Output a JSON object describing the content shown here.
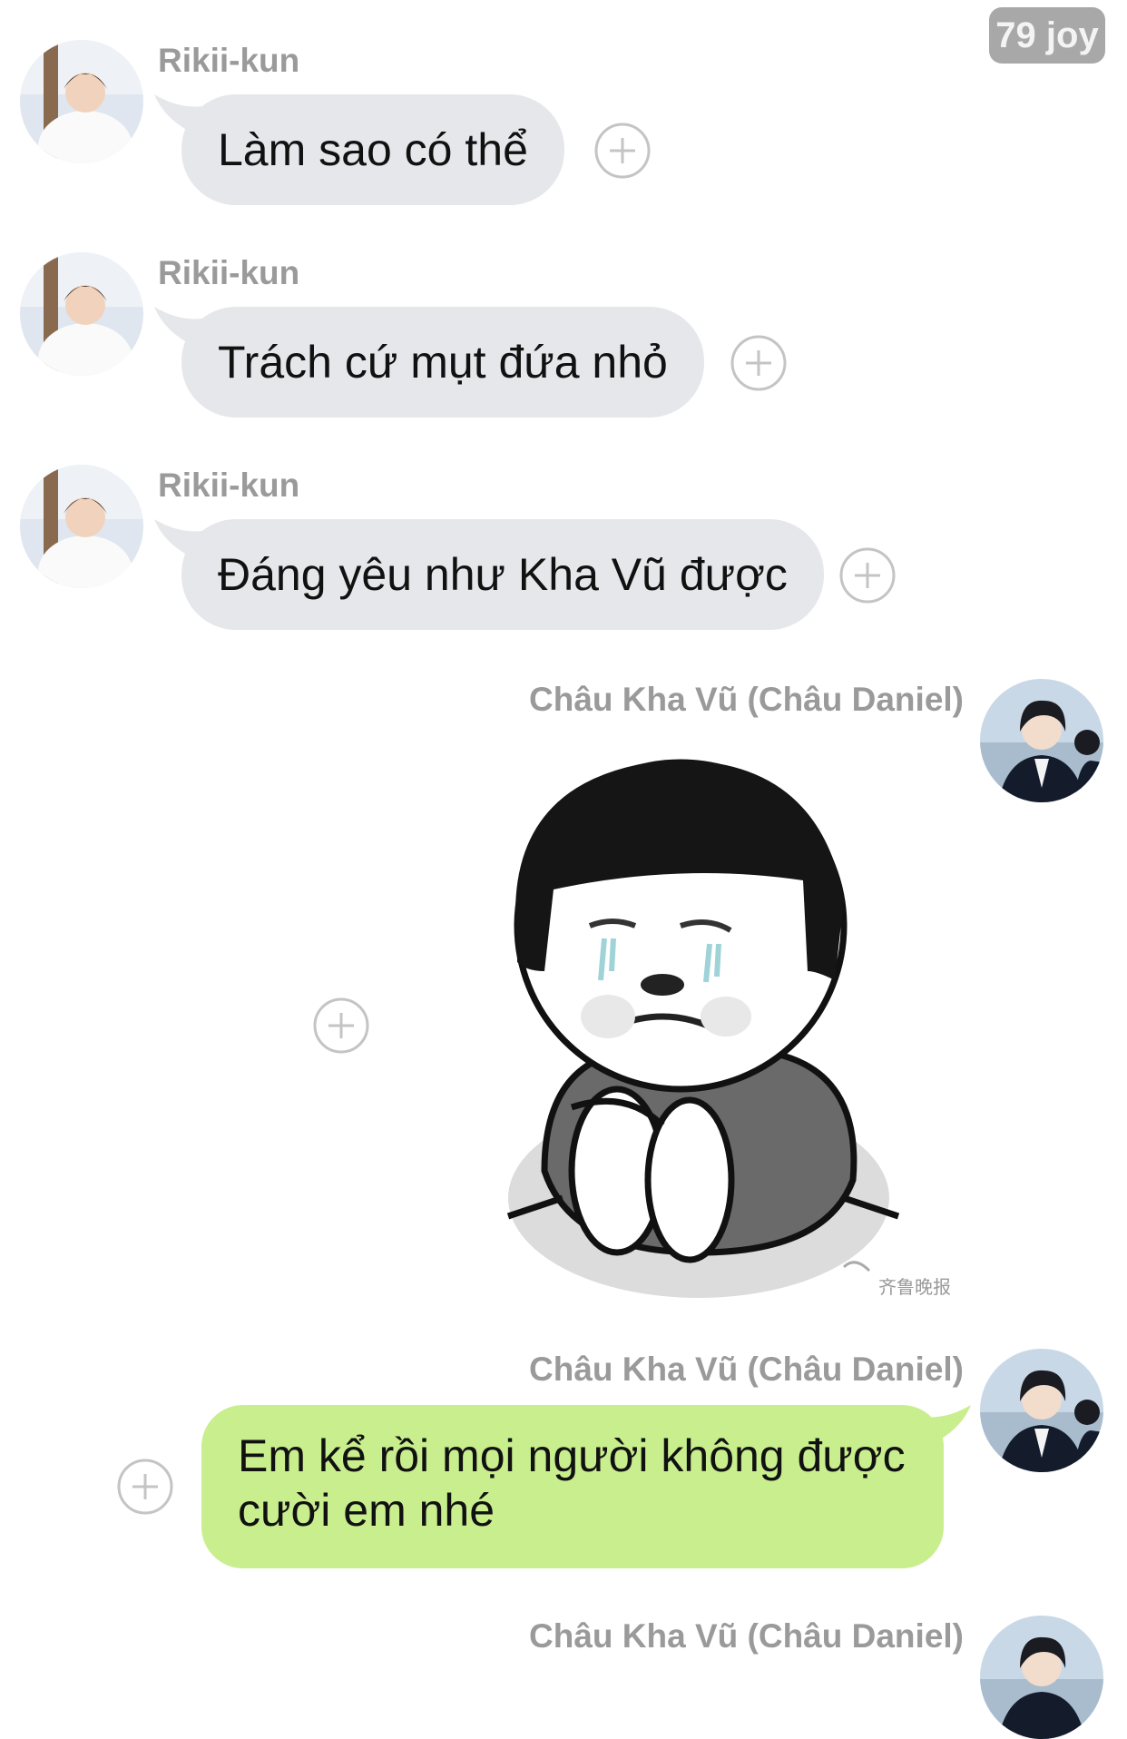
{
  "badge": "79 joy",
  "messages": [
    {
      "sender": "Rikii-kun",
      "text": "Làm sao có thể"
    },
    {
      "sender": "Rikii-kun",
      "text": "Trách cứ mụt đứa nhỏ"
    },
    {
      "sender": "Rikii-kun",
      "text": "Đáng yêu như Kha Vũ được"
    },
    {
      "sender": "Châu Kha Vũ (Châu Daniel)",
      "sticker": "crying-kid-sticker",
      "watermark": "齐鲁晚报"
    },
    {
      "sender": "Châu Kha Vũ (Châu Daniel)",
      "text": "Em kể rồi mọi người không được cười em nhé"
    },
    {
      "sender": "Châu Kha Vũ (Châu Daniel)"
    }
  ],
  "icons": {
    "add_reaction": "plus-circle-icon"
  },
  "colors": {
    "incoming_bubble": "#e5e7ea",
    "outgoing_bubble": "#c8ee8d",
    "sender_name": "#9a9a9a",
    "badge": "#a8a8a8"
  }
}
